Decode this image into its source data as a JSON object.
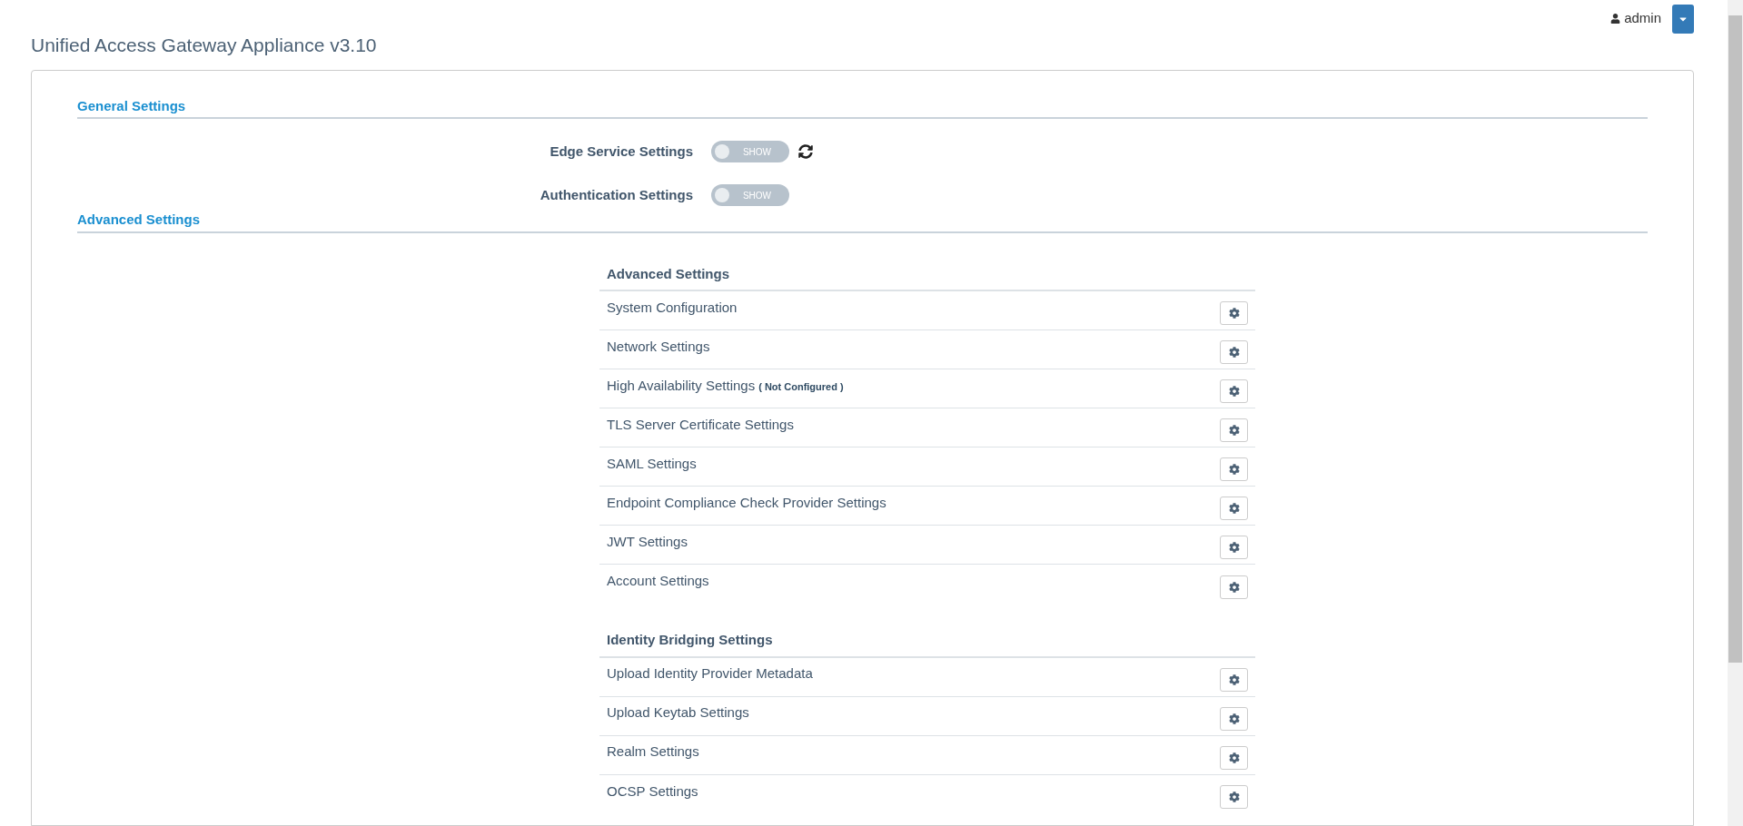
{
  "header": {
    "title": "Unified Access Gateway Appliance v3.10",
    "user": "admin"
  },
  "general_settings": {
    "heading": "General Settings",
    "toggles": [
      {
        "label": "Edge Service Settings",
        "text": "SHOW",
        "on": false,
        "refresh": true
      },
      {
        "label": "Authentication Settings",
        "text": "SHOW",
        "on": false,
        "refresh": false
      }
    ]
  },
  "advanced_settings": {
    "heading": "Advanced Settings",
    "groups": [
      {
        "heading": "Advanced Settings",
        "rows": [
          {
            "label": "System Configuration"
          },
          {
            "label": "Network Settings"
          },
          {
            "label": "High Availability Settings",
            "note": "( Not Configured )"
          },
          {
            "label": "TLS Server Certificate Settings"
          },
          {
            "label": "SAML Settings"
          },
          {
            "label": "Endpoint Compliance Check Provider Settings"
          },
          {
            "label": "JWT Settings"
          },
          {
            "label": "Account Settings"
          }
        ]
      },
      {
        "heading": "Identity Bridging Settings",
        "rows": [
          {
            "label": "Upload Identity Provider Metadata"
          },
          {
            "label": "Upload Keytab Settings"
          },
          {
            "label": "Realm Settings"
          },
          {
            "label": "OCSP Settings"
          }
        ]
      }
    ]
  }
}
